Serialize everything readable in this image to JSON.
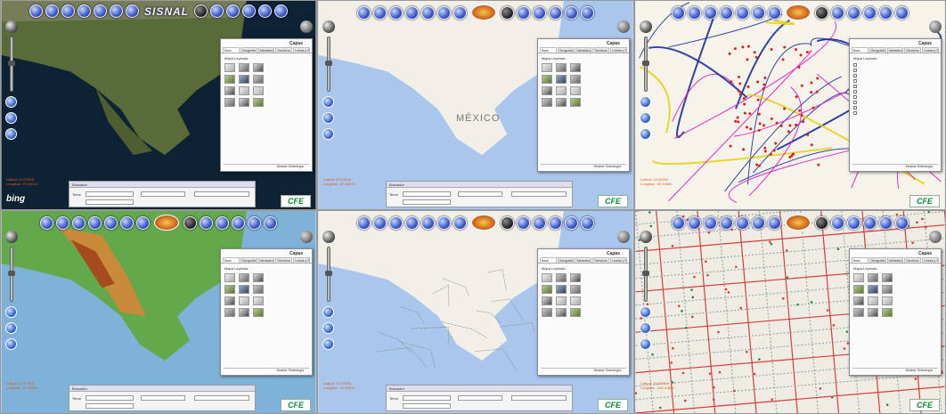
{
  "panels": [
    {
      "id": "satellite",
      "toolbar_logo": "SISNAL",
      "layers_title": "Capas",
      "tabs": [
        "Base",
        "Geografía",
        "Infraestructura",
        "Servicios",
        "Lineas y Subestaciones"
      ],
      "base_header": "Mapa Leyenda",
      "coords": [
        "Latitud: 24.07828",
        "Longitud: -97.69210"
      ],
      "search_title": "Buscador",
      "search_label": "Tema",
      "footer": "Mostrar Simbología",
      "provider": "bing",
      "brand": "CFE"
    },
    {
      "id": "street",
      "toolbar_logo": "",
      "layers_title": "Capas",
      "tabs": [
        "Base",
        "Geografía",
        "Infraestructura",
        "Servicios",
        "Lineas y Subestaciones"
      ],
      "base_header": "Mapa Leyenda",
      "map_label": "MÉXICO",
      "coords": [
        "Latitud: 24.07828",
        "Longitud: -97.69210"
      ],
      "search_title": "Buscador",
      "search_label": "Tema",
      "footer": "Mostrar Simbología",
      "brand": "CFE"
    },
    {
      "id": "network",
      "toolbar_logo": "",
      "layers_title": "Capas",
      "tabs": [
        "Base",
        "Geografía",
        "Infraestructura",
        "Servicios",
        "Lineas y Subestaciones"
      ],
      "base_header": "Mapa Leyenda",
      "coords": [
        "Latitud: 19.40250",
        "Longitud: -99.14550"
      ],
      "footer": "Mostrar Simbología",
      "brand": "CFE"
    },
    {
      "id": "relief",
      "toolbar_logo": "",
      "layers_title": "Capas",
      "tabs": [
        "Base",
        "Geografía",
        "Infraestructura",
        "Servicios",
        "Lineas y Subestaciones"
      ],
      "base_header": "Mapa Leyenda",
      "coords": [
        "Latitud: 24.07828",
        "Longitud: -97.69210"
      ],
      "search_title": "Buscador",
      "search_label": "Tema",
      "footer": "Mostrar Simbología",
      "brand": "CFE"
    },
    {
      "id": "political",
      "toolbar_logo": "",
      "layers_title": "Capas",
      "tabs": [
        "Base",
        "Geografía",
        "Infraestructura",
        "Servicios",
        "Lineas y Subestaciones"
      ],
      "base_header": "Mapa Leyenda",
      "coords": [
        "Latitud: 24.07828",
        "Longitud: -97.69210"
      ],
      "search_title": "Buscador",
      "search_label": "Tema",
      "footer": "Mostrar Simbología",
      "brand": "CFE"
    },
    {
      "id": "distribution",
      "toolbar_logo": "",
      "layers_title": "Capas",
      "tabs": [
        "Base",
        "Geografía",
        "Infraestructura",
        "Servicios",
        "Lineas y Subestaciones"
      ],
      "base_header": "Mapa Leyenda",
      "coords": [
        "Latitud: 25.67510",
        "Longitud: -100.31850"
      ],
      "footer": "Mostrar Simbología",
      "brand": "CFE"
    }
  ],
  "colors": {
    "ocean_sat": "#0d2233",
    "land_sat": "#5a6b3a",
    "ocean_street": "#a9c6ec",
    "land_street": "#f1efe7",
    "toolbar_blue": "#3b58c8",
    "accent_orange": "#e05a1a",
    "cfe_green": "#0a8a3a"
  }
}
